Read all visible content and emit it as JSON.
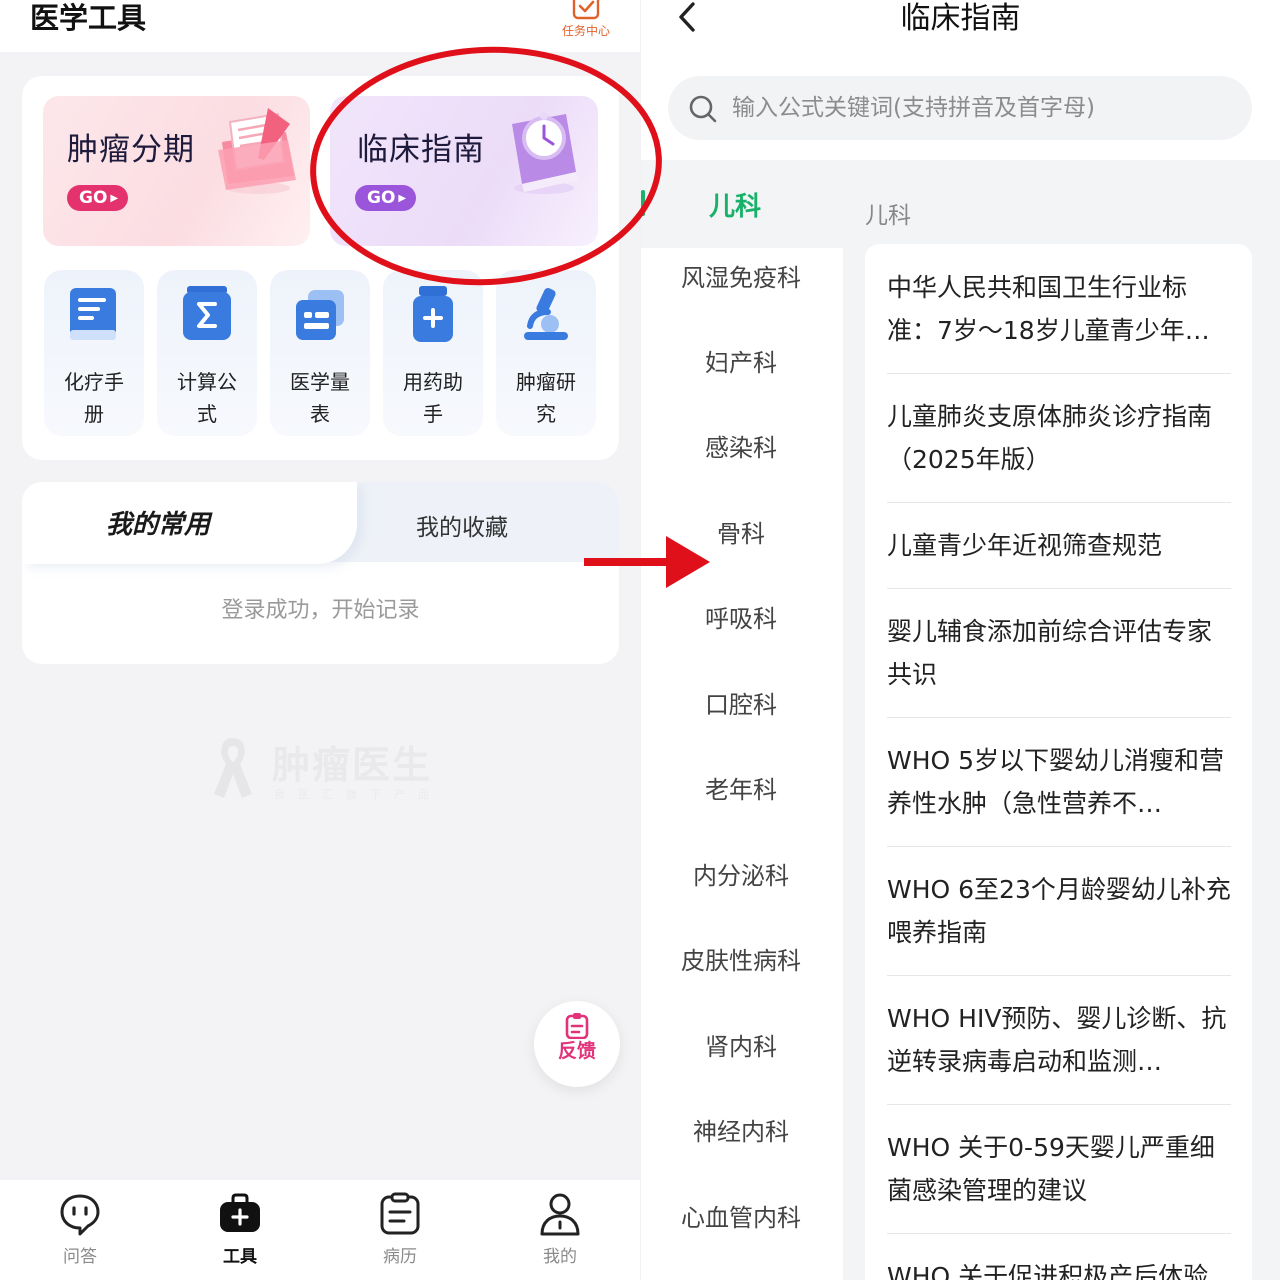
{
  "left": {
    "header": {
      "title": "医学工具",
      "task_center_label": "任务中心"
    },
    "promos": [
      {
        "title": "肿瘤分期",
        "go_label": "GO"
      },
      {
        "title": "临床指南",
        "go_label": "GO"
      }
    ],
    "tools": [
      {
        "label": "化疗手册",
        "icon": "book-icon"
      },
      {
        "label": "计算公式",
        "icon": "sigma-icon"
      },
      {
        "label": "医学量表",
        "icon": "scale-card-icon"
      },
      {
        "label": "用药助手",
        "icon": "medicine-bottle-icon"
      },
      {
        "label": "肿瘤研究",
        "icon": "microscope-icon"
      }
    ],
    "favorites": {
      "tab_mine": "我的常用",
      "tab_collect": "我的收藏",
      "hint": "登录成功，开始记录"
    },
    "watermark": {
      "title": "肿瘤医生",
      "subtitle": "良医汇旗下产品"
    },
    "feedback_label": "反馈",
    "bottom_nav": [
      {
        "label": "问答",
        "icon": "chat-bubble-icon",
        "active": false
      },
      {
        "label": "工具",
        "icon": "medical-kit-icon",
        "active": true
      },
      {
        "label": "病历",
        "icon": "clipboard-icon",
        "active": false
      },
      {
        "label": "我的",
        "icon": "person-icon",
        "active": false
      }
    ]
  },
  "right": {
    "header": {
      "title": "临床指南"
    },
    "search": {
      "placeholder": "输入公式关键词(支持拼音及首字母)"
    },
    "active_category": "儿科",
    "categories": [
      "风湿免疫科",
      "妇产科",
      "感染科",
      "骨科",
      "呼吸科",
      "口腔科",
      "老年科",
      "内分泌科",
      "皮肤性病科",
      "肾内科",
      "神经内科",
      "心血管内科"
    ],
    "section_title": "儿科",
    "guides": [
      "中华人民共和国卫生行业标准：7岁～18岁儿童青少年…",
      "儿童肺炎支原体肺炎诊疗指南（2025年版）",
      "儿童青少年近视筛查规范",
      "婴儿辅食添加前综合评估专家共识",
      "WHO 5岁以下婴幼儿消瘦和营养性水肿（急性营养不…",
      "WHO 6至23个月龄婴幼儿补充喂养指南",
      "WHO HIV预防、婴儿诊断、抗逆转录病毒启动和监测…",
      "WHO 关于0-59天婴儿严重细菌感染管理的建议",
      "WHO 关于促进积极产后体验"
    ]
  },
  "colors": {
    "accent_green": "#18b16a",
    "annotation_red": "#e0101a",
    "go_pink": "#e4326f",
    "go_purple": "#9b55db",
    "feedback_pink": "#e2327a",
    "task_orange": "#e0622a"
  }
}
